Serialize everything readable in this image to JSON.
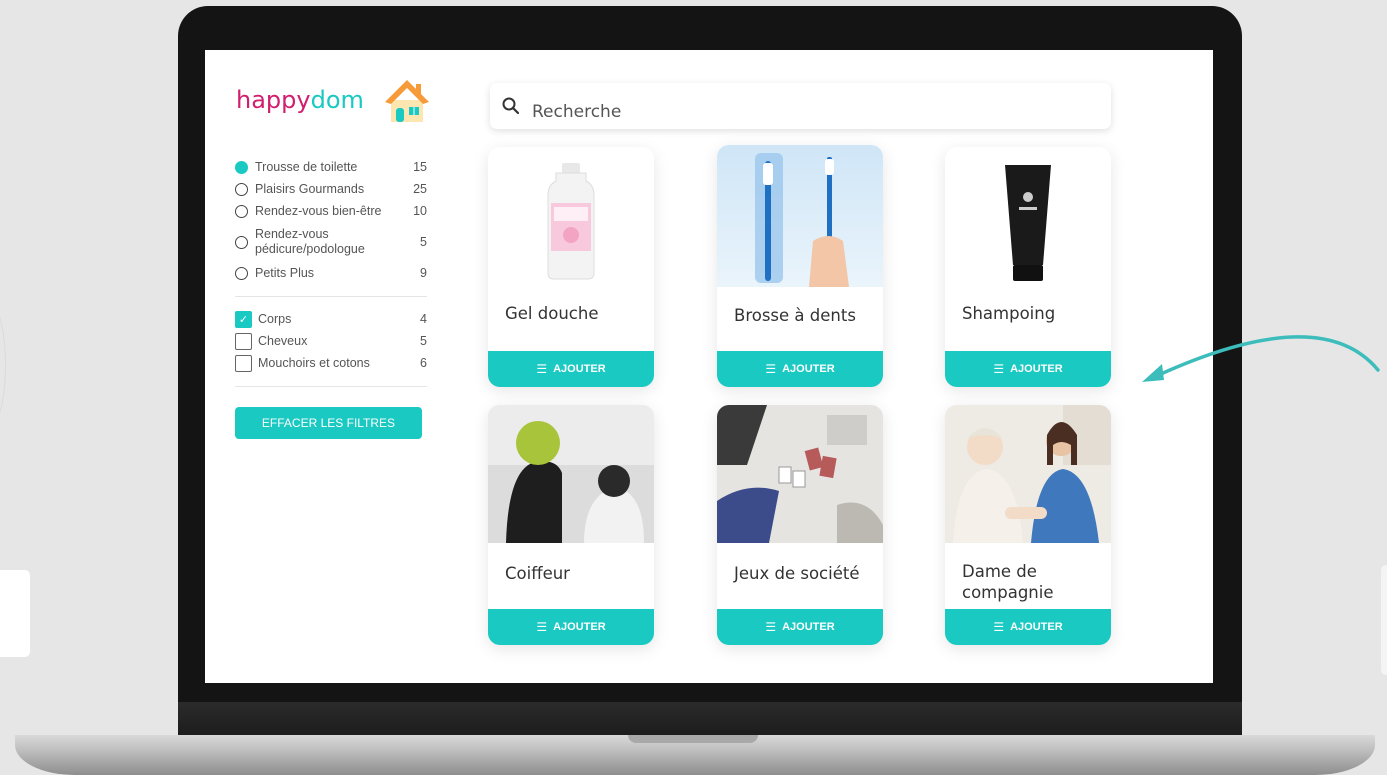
{
  "brand": {
    "part1": "happy",
    "part2": "dom"
  },
  "search": {
    "placeholder": "Recherche"
  },
  "categories": [
    {
      "label": "Trousse de toilette",
      "count": "15",
      "selected": true
    },
    {
      "label": "Plaisirs Gourmands",
      "count": "25",
      "selected": false
    },
    {
      "label": "Rendez-vous bien-être",
      "count": "10",
      "selected": false
    },
    {
      "label": "Rendez-vous pédicure/podologue",
      "count": "5",
      "selected": false
    },
    {
      "label": "Petits Plus",
      "count": "9",
      "selected": false
    }
  ],
  "subfilters": [
    {
      "label": "Corps",
      "count": "4",
      "checked": true
    },
    {
      "label": "Cheveux",
      "count": "5",
      "checked": false
    },
    {
      "label": "Mouchoirs et cotons",
      "count": "6",
      "checked": false
    }
  ],
  "clear_filters_label": "EFFACER LES FILTRES",
  "products": [
    {
      "title": "Gel douche",
      "image": "shower-gel-bottle"
    },
    {
      "title": "Brosse à dents",
      "image": "toothbrush"
    },
    {
      "title": "Shampoing",
      "image": "shampoo-tube"
    },
    {
      "title": "Coiffeur",
      "image": "hairdresser-photo"
    },
    {
      "title": "Jeux de société",
      "image": "board-games-photo"
    },
    {
      "title": "Dame de compagnie",
      "image": "companion-photo"
    }
  ],
  "add_label": "AJOUTER",
  "colors": {
    "accent": "#19c9c2",
    "brand_pink": "#d21e6f"
  }
}
